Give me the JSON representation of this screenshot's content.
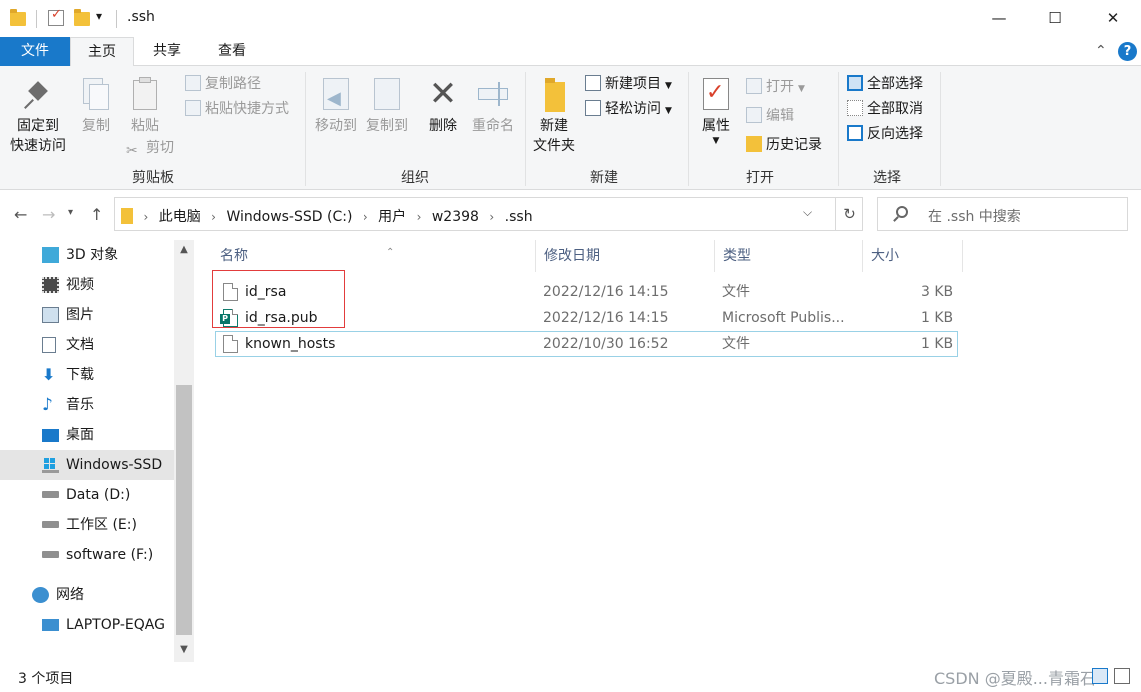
{
  "window": {
    "title": ".ssh",
    "quick_access_dropdown": "▾",
    "minimize": "—",
    "maximize": "☐",
    "close": "✕"
  },
  "tabs": [
    {
      "label": "文件"
    },
    {
      "label": "主页"
    },
    {
      "label": "共享"
    },
    {
      "label": "查看"
    }
  ],
  "ribbon": {
    "collapse": "⌃",
    "help": "?",
    "clipboard": {
      "group_label": "剪贴板",
      "pin_label_1": "固定到",
      "pin_label_2": "快速访问",
      "copy_label": "复制",
      "paste_label": "粘贴",
      "copy_path": "复制路径",
      "paste_shortcut": "粘贴快捷方式",
      "cut": "剪切"
    },
    "organize": {
      "group_label": "组织",
      "move_to": "移动到",
      "copy_to": "复制到",
      "delete": "删除",
      "rename": "重命名"
    },
    "new": {
      "group_label": "新建",
      "new_folder_1": "新建",
      "new_folder_2": "文件夹",
      "new_item": "新建项目",
      "easy_access": "轻松访问"
    },
    "open": {
      "group_label": "打开",
      "properties": "属性",
      "open": "打开",
      "edit": "编辑",
      "history": "历史记录"
    },
    "select": {
      "group_label": "选择",
      "select_all": "全部选择",
      "select_none": "全部取消",
      "invert": "反向选择"
    }
  },
  "address": {
    "crumbs": [
      "此电脑",
      "Windows-SSD (C:)",
      "用户",
      "w2398",
      ".ssh"
    ],
    "search_placeholder": "在 .ssh 中搜索"
  },
  "nav_pane": [
    {
      "label": "3D 对象",
      "icon": "3d-objects-icon"
    },
    {
      "label": "视频",
      "icon": "video-icon"
    },
    {
      "label": "图片",
      "icon": "pictures-icon"
    },
    {
      "label": "文档",
      "icon": "documents-icon"
    },
    {
      "label": "下载",
      "icon": "download-icon"
    },
    {
      "label": "音乐",
      "icon": "music-icon"
    },
    {
      "label": "桌面",
      "icon": "desktop-icon"
    },
    {
      "label": "Windows-SSD",
      "icon": "windows-drive-icon"
    },
    {
      "label": "Data (D:)",
      "icon": "drive-icon"
    },
    {
      "label": "工作区 (E:)",
      "icon": "drive-icon"
    },
    {
      "label": "software (F:)",
      "icon": "drive-icon"
    },
    {
      "label": "网络",
      "icon": "network-icon"
    },
    {
      "label": "LAPTOP-EQAG",
      "icon": "computer-icon"
    }
  ],
  "columns": {
    "name": "名称",
    "modified": "修改日期",
    "type": "类型",
    "size": "大小"
  },
  "files": [
    {
      "name": "id_rsa",
      "modified": "2022/12/16 14:15",
      "type": "文件",
      "size": "3 KB"
    },
    {
      "name": "id_rsa.pub",
      "modified": "2022/12/16 14:15",
      "type": "Microsoft Publis...",
      "size": "1 KB"
    },
    {
      "name": "known_hosts",
      "modified": "2022/10/30 16:52",
      "type": "文件",
      "size": "1 KB"
    }
  ],
  "status": {
    "item_count": "3 个项目",
    "watermark": "CSDN @夏殿...青霜石"
  },
  "colors": {
    "file_tab": "#1979ca",
    "highlight_box": "#e23c3c",
    "selected_nav": "#e5e5e5"
  }
}
